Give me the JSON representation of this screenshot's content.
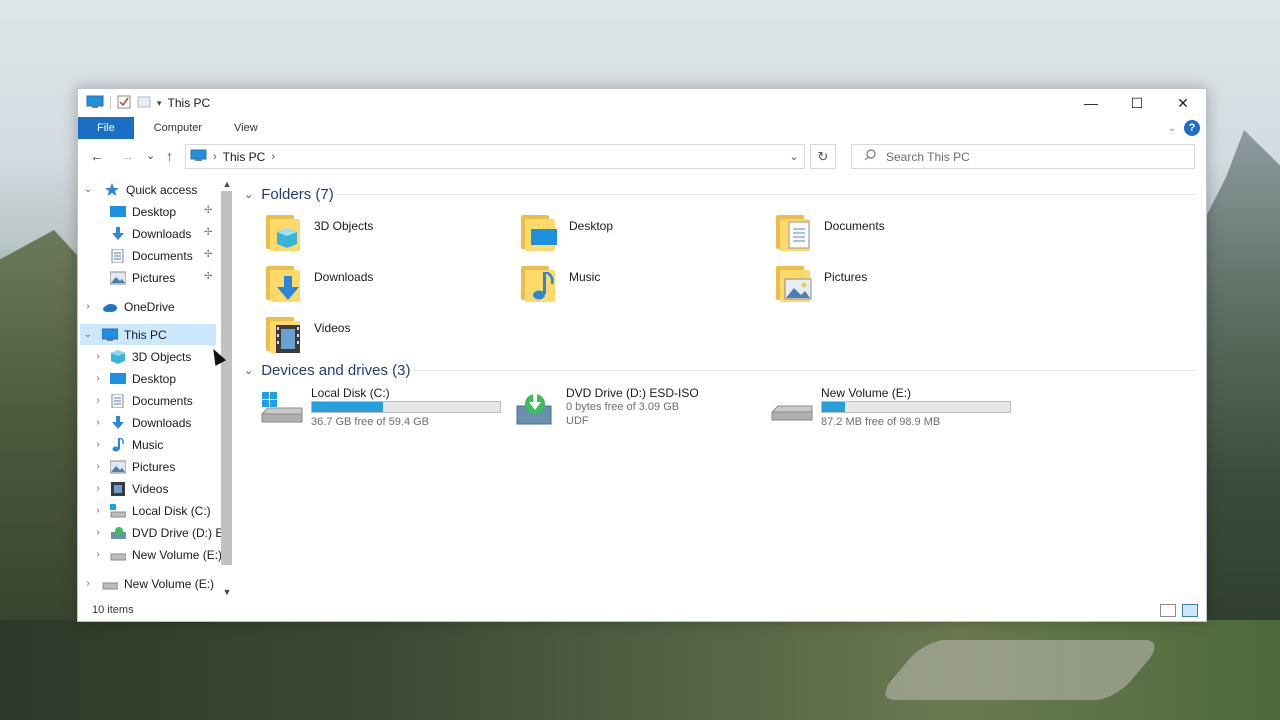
{
  "window": {
    "title": "This PC",
    "controls": {
      "minimize": "—",
      "maximize": "☐",
      "close": "✕"
    }
  },
  "ribbon": {
    "tabs": [
      "File",
      "Computer",
      "View"
    ]
  },
  "navigation": {
    "back": "←",
    "forward": "→",
    "recent": "⌄",
    "up": "↑",
    "breadcrumb": "This PC",
    "search_placeholder": "Search This PC"
  },
  "sidebar": {
    "quick_access": {
      "label": "Quick access",
      "items": [
        "Desktop",
        "Downloads",
        "Documents",
        "Pictures"
      ]
    },
    "onedrive": "OneDrive",
    "this_pc": {
      "label": "This PC",
      "items": [
        "3D Objects",
        "Desktop",
        "Documents",
        "Downloads",
        "Music",
        "Pictures",
        "Videos",
        "Local Disk (C:)",
        "DVD Drive (D:) E!",
        "New Volume (E:)"
      ]
    },
    "new_volume_root": "New Volume (E:)"
  },
  "folders_group": {
    "header": "Folders (7)",
    "items": [
      "3D Objects",
      "Desktop",
      "Documents",
      "Downloads",
      "Music",
      "Pictures",
      "Videos"
    ]
  },
  "drives_group": {
    "header": "Devices and drives (3)",
    "items": [
      {
        "name": "Local Disk (C:)",
        "free": "36.7 GB free of 59.4 GB",
        "used_fraction": 0.38,
        "fs": ""
      },
      {
        "name": "DVD Drive (D:) ESD-ISO",
        "free": "0 bytes free of 3.09 GB",
        "used_fraction": null,
        "fs": "UDF"
      },
      {
        "name": "New Volume (E:)",
        "free": "87.2 MB free of 98.9 MB",
        "used_fraction": 0.12,
        "fs": ""
      }
    ]
  },
  "status": {
    "items": "10 items"
  },
  "colors": {
    "accent": "#1a6fc4",
    "bar": "#26a0da",
    "group_header": "#1e3c78",
    "selection": "#cce8ff"
  }
}
